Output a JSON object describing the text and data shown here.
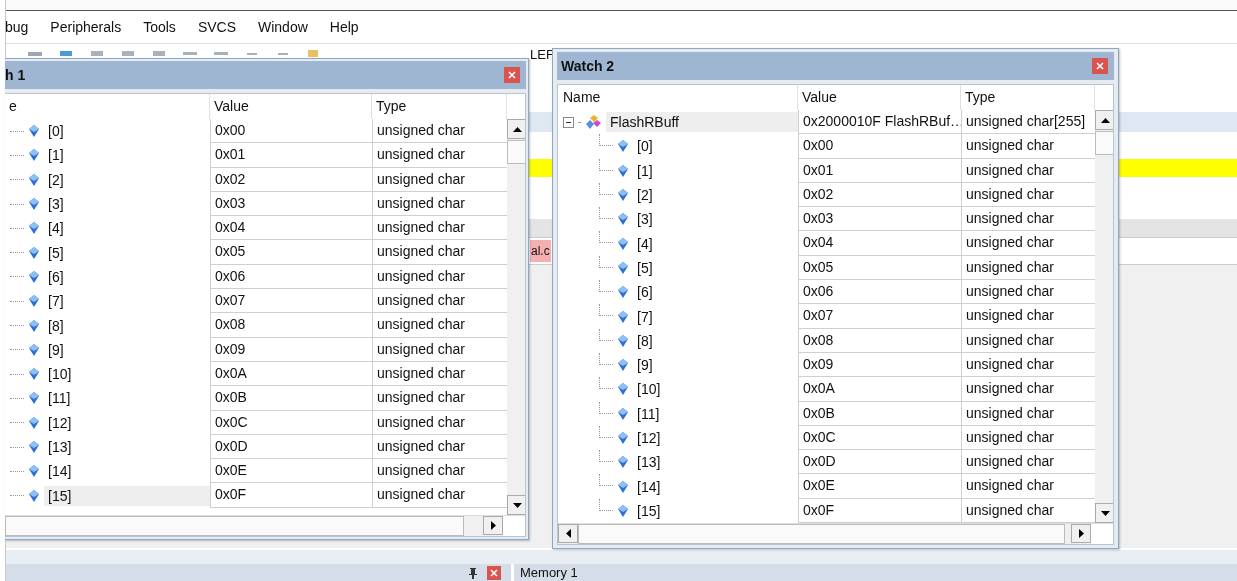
{
  "menu": [
    "bug",
    "Peripherals",
    "Tools",
    "SVCS",
    "Window",
    "Help"
  ],
  "toolbar_fragment": "LEF",
  "file_tab": "al.c",
  "watches": [
    {
      "title": "h 1",
      "columns": [
        "e",
        "Value",
        "Type"
      ],
      "rows": [
        {
          "name": "[0]",
          "value": "0x00",
          "type": "unsigned char",
          "selected": false
        },
        {
          "name": "[1]",
          "value": "0x01",
          "type": "unsigned char",
          "selected": false
        },
        {
          "name": "[2]",
          "value": "0x02",
          "type": "unsigned char",
          "selected": false
        },
        {
          "name": "[3]",
          "value": "0x03",
          "type": "unsigned char",
          "selected": false
        },
        {
          "name": "[4]",
          "value": "0x04",
          "type": "unsigned char",
          "selected": false
        },
        {
          "name": "[5]",
          "value": "0x05",
          "type": "unsigned char",
          "selected": false
        },
        {
          "name": "[6]",
          "value": "0x06",
          "type": "unsigned char",
          "selected": false
        },
        {
          "name": "[7]",
          "value": "0x07",
          "type": "unsigned char",
          "selected": false
        },
        {
          "name": "[8]",
          "value": "0x08",
          "type": "unsigned char",
          "selected": false
        },
        {
          "name": "[9]",
          "value": "0x09",
          "type": "unsigned char",
          "selected": false
        },
        {
          "name": "[10]",
          "value": "0x0A",
          "type": "unsigned char",
          "selected": false
        },
        {
          "name": "[11]",
          "value": "0x0B",
          "type": "unsigned char",
          "selected": false
        },
        {
          "name": "[12]",
          "value": "0x0C",
          "type": "unsigned char",
          "selected": false
        },
        {
          "name": "[13]",
          "value": "0x0D",
          "type": "unsigned char",
          "selected": false
        },
        {
          "name": "[14]",
          "value": "0x0E",
          "type": "unsigned char",
          "selected": false
        },
        {
          "name": "[15]",
          "value": "0x0F",
          "type": "unsigned char",
          "selected": true
        }
      ]
    },
    {
      "title": "Watch 2",
      "columns": [
        "Name",
        "Value",
        "Type"
      ],
      "rows": [
        {
          "name": "FlashRBuff",
          "value": "0x2000010F FlashRBuf…",
          "type": "unsigned char[255]",
          "selected": true,
          "expanded": true,
          "children": [
            {
              "name": "[0]",
              "value": "0x00",
              "type": "unsigned char",
              "selected": false
            },
            {
              "name": "[1]",
              "value": "0x01",
              "type": "unsigned char",
              "selected": false
            },
            {
              "name": "[2]",
              "value": "0x02",
              "type": "unsigned char",
              "selected": false
            },
            {
              "name": "[3]",
              "value": "0x03",
              "type": "unsigned char",
              "selected": false
            },
            {
              "name": "[4]",
              "value": "0x04",
              "type": "unsigned char",
              "selected": false
            },
            {
              "name": "[5]",
              "value": "0x05",
              "type": "unsigned char",
              "selected": false
            },
            {
              "name": "[6]",
              "value": "0x06",
              "type": "unsigned char",
              "selected": false
            },
            {
              "name": "[7]",
              "value": "0x07",
              "type": "unsigned char",
              "selected": false
            },
            {
              "name": "[8]",
              "value": "0x08",
              "type": "unsigned char",
              "selected": false
            },
            {
              "name": "[9]",
              "value": "0x09",
              "type": "unsigned char",
              "selected": false
            },
            {
              "name": "[10]",
              "value": "0x0A",
              "type": "unsigned char",
              "selected": false
            },
            {
              "name": "[11]",
              "value": "0x0B",
              "type": "unsigned char",
              "selected": false
            },
            {
              "name": "[12]",
              "value": "0x0C",
              "type": "unsigned char",
              "selected": false
            },
            {
              "name": "[13]",
              "value": "0x0D",
              "type": "unsigned char",
              "selected": false
            },
            {
              "name": "[14]",
              "value": "0x0E",
              "type": "unsigned char",
              "selected": false
            },
            {
              "name": "[15]",
              "value": "0x0F",
              "type": "unsigned char",
              "selected": false
            }
          ]
        }
      ]
    }
  ],
  "bottom_panel": {
    "tab": "Memory 1"
  }
}
